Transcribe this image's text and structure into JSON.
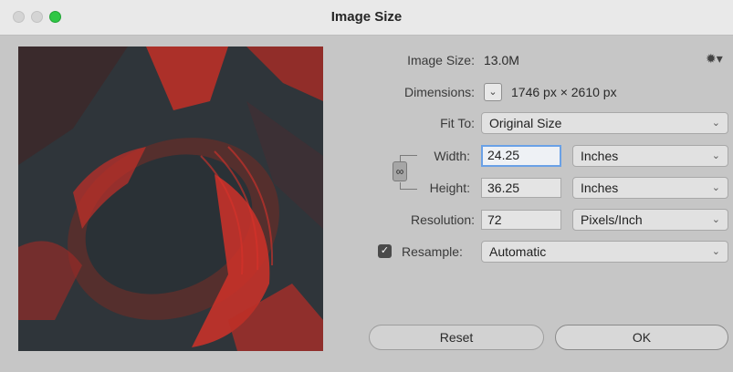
{
  "window": {
    "title": "Image Size"
  },
  "image_size": {
    "label": "Image Size:",
    "value": "13.0M"
  },
  "dimensions": {
    "label": "Dimensions:",
    "value": "1746 px  ×  2610 px"
  },
  "fit_to": {
    "label": "Fit To:",
    "selected": "Original Size"
  },
  "width": {
    "label": "Width:",
    "value": "24.25",
    "unit": "Inches"
  },
  "height": {
    "label": "Height:",
    "value": "36.25",
    "unit": "Inches"
  },
  "resolution": {
    "label": "Resolution:",
    "value": "72",
    "unit": "Pixels/Inch"
  },
  "resample": {
    "label": "Resample:",
    "checked": true,
    "selected": "Automatic"
  },
  "buttons": {
    "reset": "Reset",
    "ok": "OK"
  },
  "colors": {
    "preview_dark": "#2e3439",
    "preview_red": "#d9322a"
  },
  "icons": {
    "gear": "gear-icon",
    "link": "chain-link-icon",
    "chevron": "chevron-down-icon"
  }
}
